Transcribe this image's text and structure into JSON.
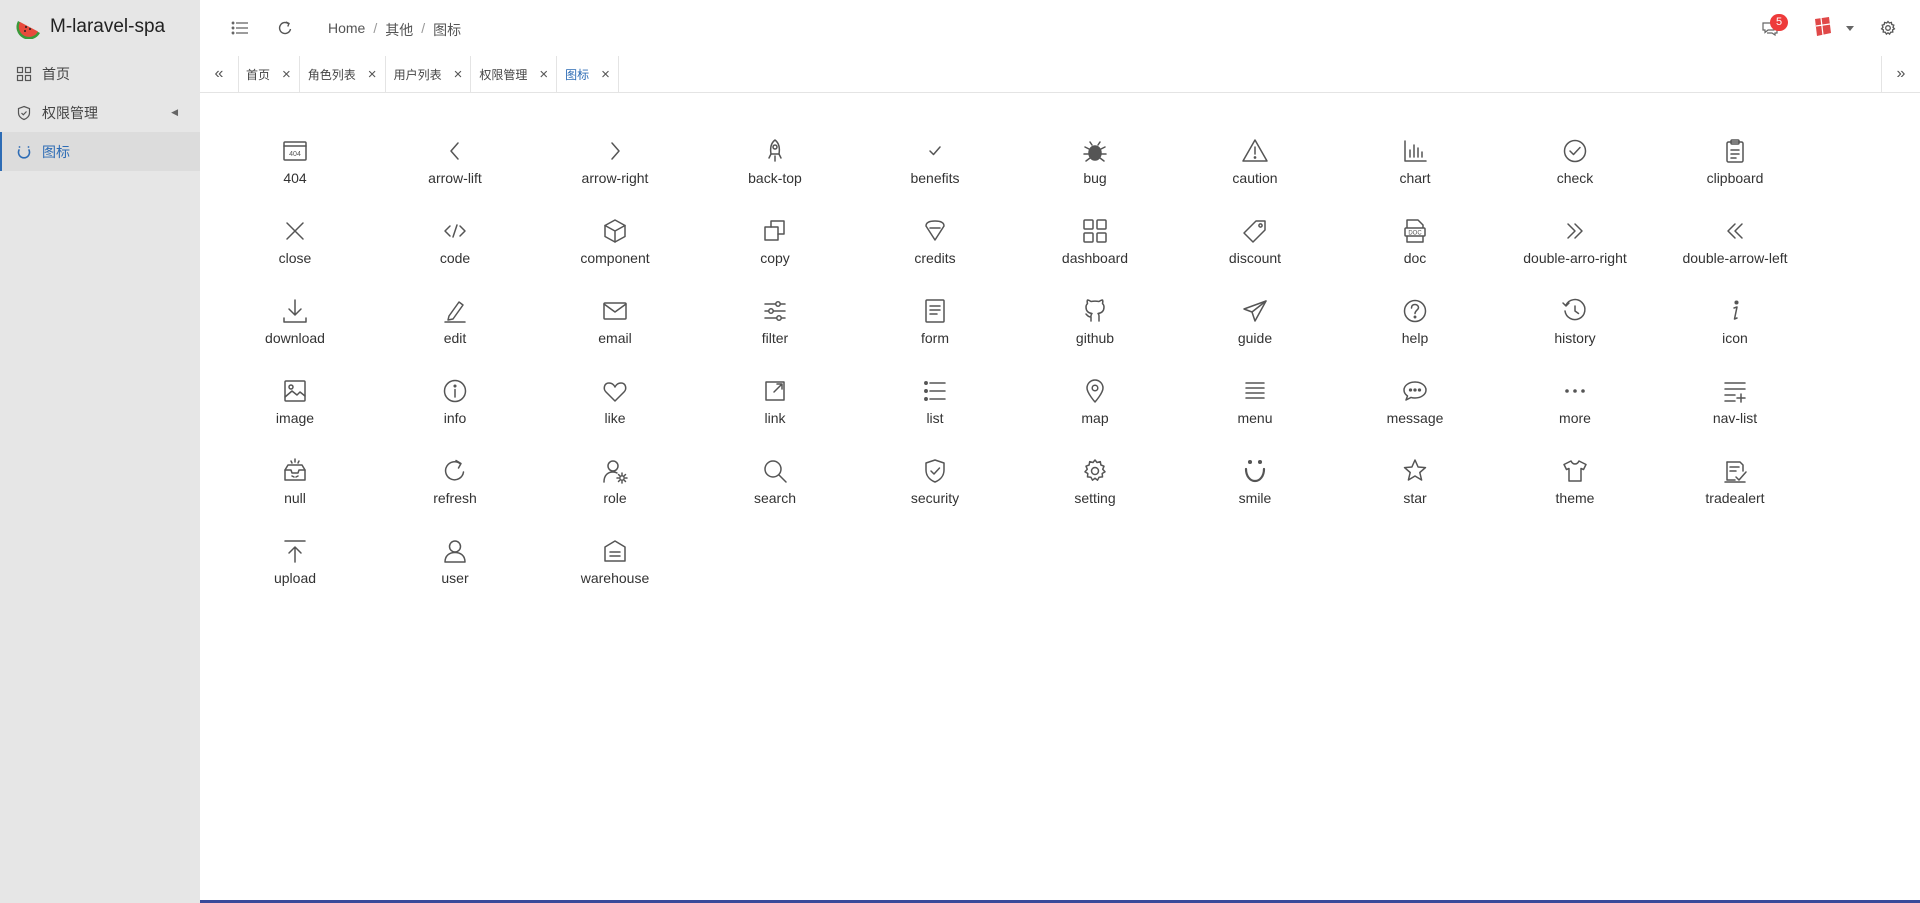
{
  "app": {
    "title": "M-laravel-spa"
  },
  "sidebar": {
    "items": [
      {
        "label": "首页",
        "icon": "dashboard-icon"
      },
      {
        "label": "权限管理",
        "icon": "shield-icon",
        "has_submenu": true
      },
      {
        "label": "图标",
        "icon": "loading-icon",
        "active": true
      }
    ]
  },
  "header": {
    "breadcrumb": [
      "Home",
      "其他",
      "图标"
    ],
    "message_count": "5"
  },
  "tabs": [
    {
      "label": "首页",
      "active": false
    },
    {
      "label": "角色列表",
      "active": false
    },
    {
      "label": "用户列表",
      "active": false
    },
    {
      "label": "权限管理",
      "active": false
    },
    {
      "label": "图标",
      "active": true
    }
  ],
  "icons": [
    "404",
    "arrow-lift",
    "arrow-right",
    "back-top",
    "benefits",
    "bug",
    "caution",
    "chart",
    "check",
    "clipboard",
    "close",
    "code",
    "component",
    "copy",
    "credits",
    "dashboard",
    "discount",
    "doc",
    "double-arro-right",
    "double-arrow-left",
    "download",
    "edit",
    "email",
    "filter",
    "form",
    "github",
    "guide",
    "help",
    "history",
    "icon",
    "image",
    "info",
    "like",
    "link",
    "list",
    "map",
    "menu",
    "message",
    "more",
    "nav-list",
    "null",
    "refresh",
    "role",
    "search",
    "security",
    "setting",
    "smile",
    "star",
    "theme",
    "tradealert",
    "upload",
    "user",
    "warehouse"
  ],
  "colors": {
    "accent": "#2d6cb5",
    "sidebar_bg": "#e6e6e6",
    "badge": "#ee3b3b"
  }
}
